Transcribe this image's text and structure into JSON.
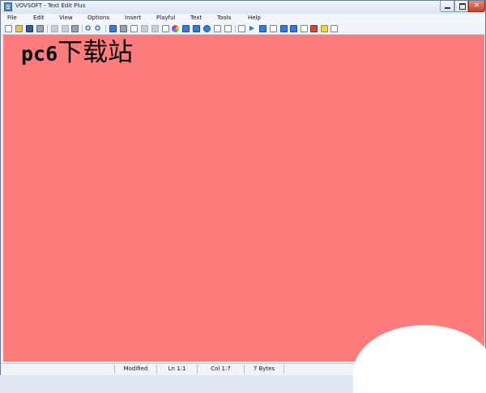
{
  "window": {
    "title": "VOVSOFT - Text Edit Plus",
    "close_glyph": "✕"
  },
  "menu": [
    "File",
    "Edit",
    "View",
    "Options",
    "Insert",
    "Playful",
    "Text",
    "Tools",
    "Help"
  ],
  "toolbar": {
    "icons": [
      "new-document-icon",
      "open-folder-icon",
      "save-icon",
      "print-icon",
      "cut-icon",
      "copy-icon",
      "paste-icon",
      "find-icon",
      "replace-icon",
      "insert-image-icon",
      "insert-table-icon",
      "font-icon",
      "lock-icon",
      "stamp-icon",
      "calendar-icon",
      "color-picker-icon",
      "brush-icon",
      "filter-icon",
      "at-sign-icon",
      "list-icon",
      "keyboard-icon",
      "indent-icon",
      "arrow-right-icon",
      "arrow-down-icon",
      "document-icon",
      "upload-icon",
      "download-icon",
      "page-icon",
      "date-icon",
      "warning-icon",
      "notes-icon"
    ]
  },
  "editor": {
    "content_latin": "pc6",
    "content_cjk": "下载站",
    "background": "#ff7c7c"
  },
  "status": {
    "state": "Modified",
    "line": "Ln 1:1",
    "column": "Col 1:7",
    "size": "7 Bytes"
  }
}
